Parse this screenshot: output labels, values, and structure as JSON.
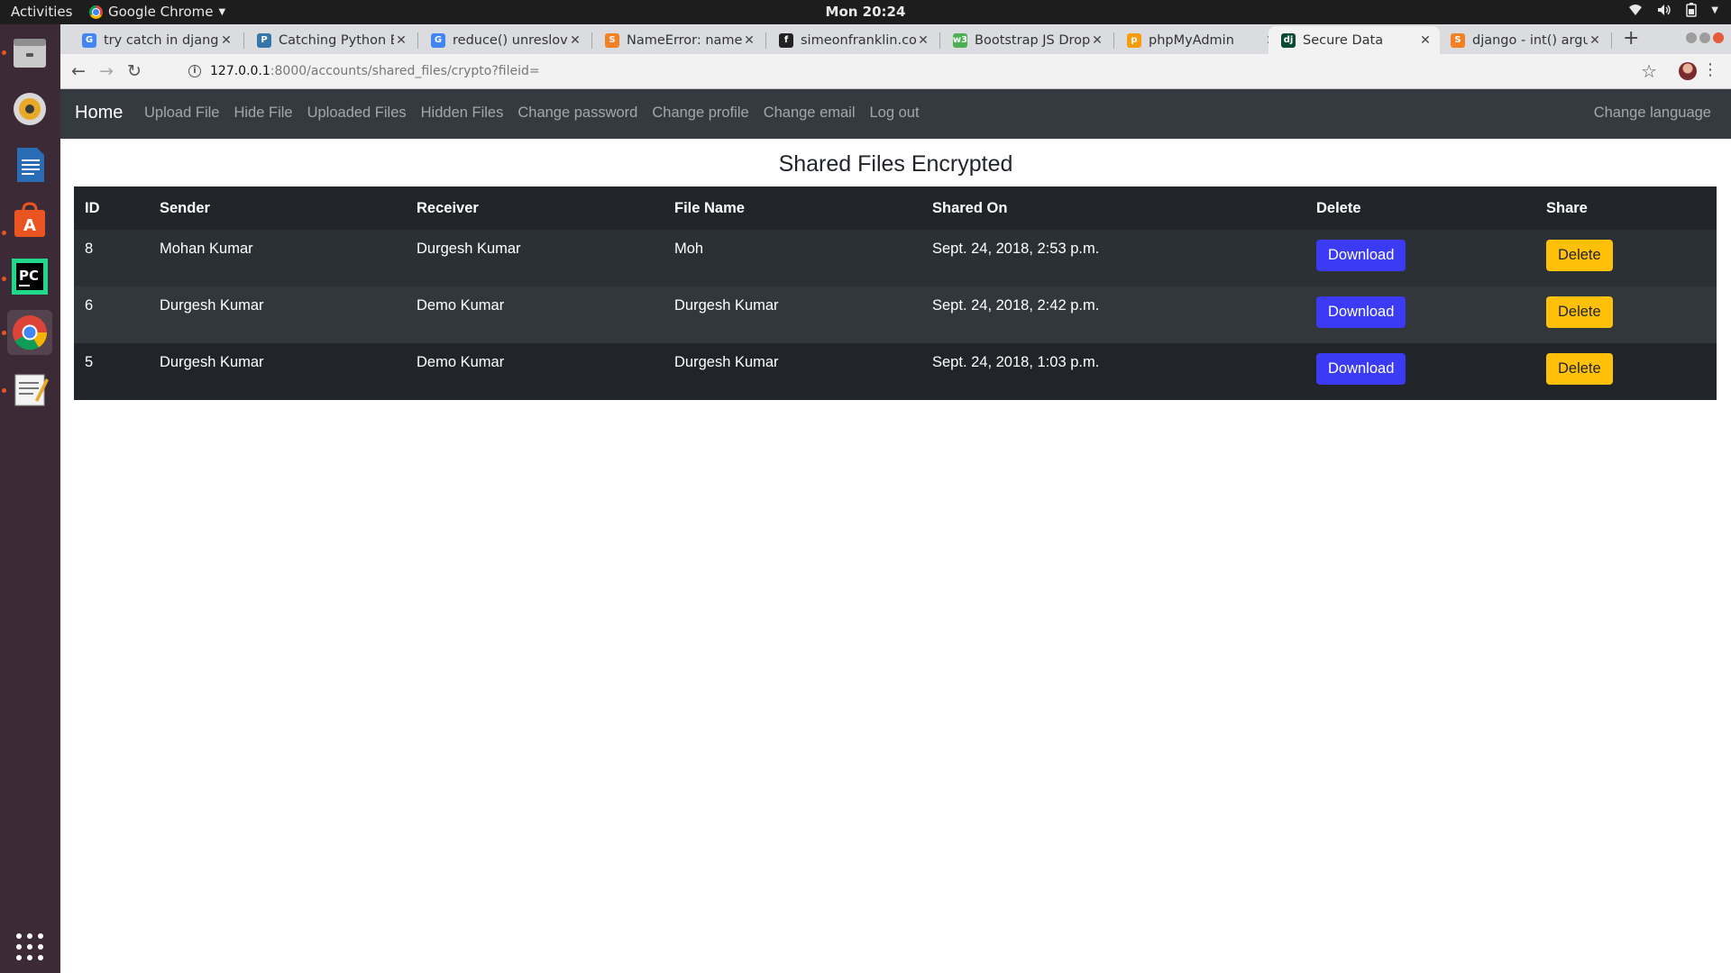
{
  "topbar": {
    "activities": "Activities",
    "app_name": "Google Chrome",
    "clock": "Mon 20:24"
  },
  "dock": {
    "items": [
      {
        "name": "files-app"
      },
      {
        "name": "rhythmbox-app"
      },
      {
        "name": "writer-app"
      },
      {
        "name": "software-center-app"
      },
      {
        "name": "pycharm-app"
      },
      {
        "name": "chrome-app"
      },
      {
        "name": "text-editor-app"
      }
    ]
  },
  "tabs": [
    {
      "title": "try catch in django",
      "icon": "google-icon",
      "color": "#4285f4"
    },
    {
      "title": "Catching Python E",
      "icon": "python-icon",
      "color": "#3776ab"
    },
    {
      "title": "reduce() unreslove",
      "icon": "google-icon",
      "color": "#4285f4"
    },
    {
      "title": "NameError: name",
      "icon": "stackoverflow-icon",
      "color": "#f48024"
    },
    {
      "title": "simeonfranklin.co",
      "icon": "site-icon",
      "color": "#222222"
    },
    {
      "title": "Bootstrap JS Drop",
      "icon": "w3schools-icon",
      "color": "#4caf50"
    },
    {
      "title": "phpMyAdmin",
      "icon": "phpmyadmin-icon",
      "color": "#f89c0e"
    },
    {
      "title": "Secure Data",
      "icon": "django-icon",
      "color": "#0c4b33",
      "active": true
    },
    {
      "title": "django - int() argu",
      "icon": "stackoverflow-icon",
      "color": "#f48024"
    }
  ],
  "address": {
    "host": "127.0.0.1",
    "rest": ":8000/accounts/shared_files/crypto?fileid="
  },
  "navbar": {
    "brand": "Home",
    "links": [
      "Upload File",
      "Hide File",
      "Uploaded Files",
      "Hidden Files",
      "Change password",
      "Change profile",
      "Change email",
      "Log out"
    ],
    "right": "Change language"
  },
  "page": {
    "title": "Shared Files Encrypted"
  },
  "table": {
    "headers": [
      "ID",
      "Sender",
      "Receiver",
      "File Name",
      "Shared On",
      "Delete",
      "Share"
    ],
    "rows": [
      {
        "id": "8",
        "sender": "Mohan Kumar",
        "receiver": "Durgesh Kumar",
        "file_name": "Moh",
        "shared_on": "Sept. 24, 2018, 2:53 p.m.",
        "download": "Download",
        "delete": "Delete"
      },
      {
        "id": "6",
        "sender": "Durgesh Kumar",
        "receiver": "Demo Kumar",
        "file_name": "Durgesh Kumar",
        "shared_on": "Sept. 24, 2018, 2:42 p.m.",
        "download": "Download",
        "delete": "Delete"
      },
      {
        "id": "5",
        "sender": "Durgesh Kumar",
        "receiver": "Demo Kumar",
        "file_name": "Durgesh Kumar",
        "shared_on": "Sept. 24, 2018, 1:03 p.m.",
        "download": "Download",
        "delete": "Delete"
      }
    ]
  },
  "colors": {
    "navbar_bg": "#343a40",
    "table_bg": "#212529",
    "download_btn": "#3b3bf5",
    "delete_btn": "#ffc107"
  }
}
